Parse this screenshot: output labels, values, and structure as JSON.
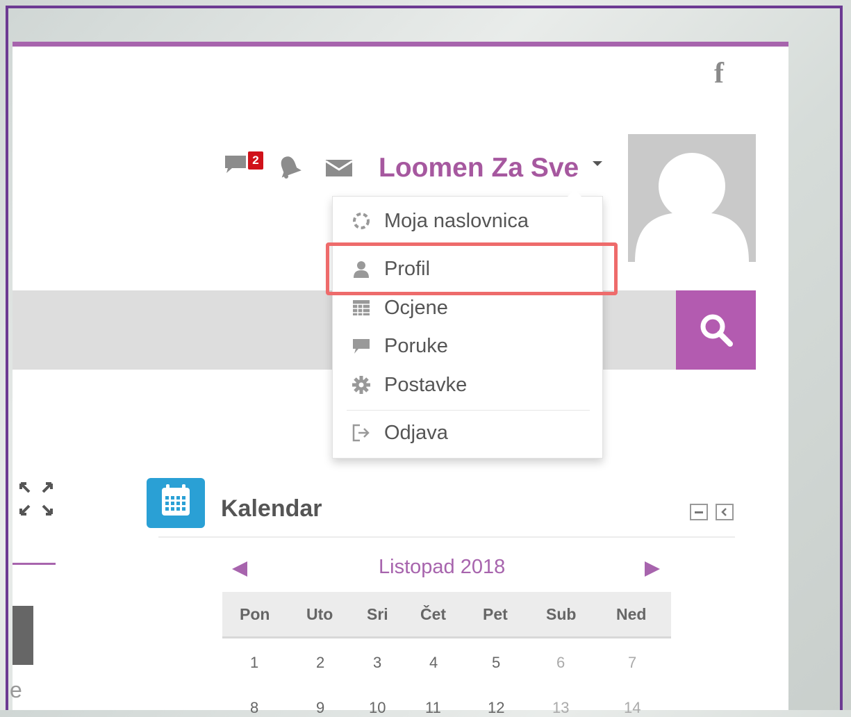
{
  "header": {
    "facebook_glyph": "f",
    "notification_badge": "2",
    "username": "Loomen Za Sve"
  },
  "user_menu": {
    "items": [
      {
        "label": "Moja naslovnica",
        "icon": "dashboard-icon"
      },
      {
        "label": "Profil",
        "icon": "user-icon"
      },
      {
        "label": "Ocjene",
        "icon": "grades-table-icon"
      },
      {
        "label": "Poruke",
        "icon": "message-icon"
      },
      {
        "label": "Postavke",
        "icon": "gear-icon"
      },
      {
        "label": "Odjava",
        "icon": "logout-icon"
      }
    ]
  },
  "left_column": {
    "partial_letter": "e"
  },
  "calendar": {
    "title": "Kalendar",
    "month": "Listopad 2018",
    "weekdays": [
      "Pon",
      "Uto",
      "Sri",
      "Čet",
      "Pet",
      "Sub",
      "Ned"
    ],
    "week1": [
      "1",
      "2",
      "3",
      "4",
      "5",
      "6",
      "7"
    ],
    "week2": [
      "8",
      "9",
      "10",
      "11",
      "12",
      "13",
      "14"
    ]
  },
  "colors": {
    "brand_purple": "#a764ad",
    "frame_purple": "#6c3a92",
    "calendar_blue": "#2aa0d5",
    "badge_red": "#d0111a",
    "highlight_red": "#ee6b6b"
  }
}
